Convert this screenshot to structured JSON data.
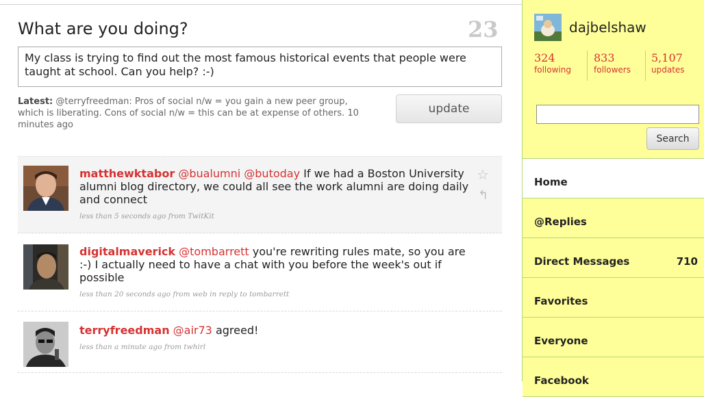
{
  "compose": {
    "heading": "What are you doing?",
    "char_count": "23",
    "status_text": "My class is trying to find out the most famous historical events that people were taught at school. Can you help? :-)",
    "latest_label": "Latest:",
    "latest_text": "@terryfreedman: Pros of social n/w = you gain a new peer group, which is liberating. Cons of social n/w = this can be at expense of others. 10 minutes ago",
    "update_label": "update"
  },
  "timeline": [
    {
      "user": "matthewktabor",
      "parts": [
        {
          "text": "@bualumni",
          "mention": true
        },
        {
          "text": " ",
          "mention": false
        },
        {
          "text": "@butoday",
          "mention": true
        },
        {
          "text": " If we had a Boston University alumni blog directory, we could all see the work alumni are doing daily and connect",
          "mention": false
        }
      ],
      "meta": "less than 5 seconds ago from TwitKit"
    },
    {
      "user": "digitalmaverick",
      "parts": [
        {
          "text": "@tombarrett",
          "mention": true
        },
        {
          "text": " you're rewriting rules mate, so you are :-) I actually need to have a chat with you before the week's out if possible",
          "mention": false
        }
      ],
      "meta": "less than 20 seconds ago from web in reply to tombarrett"
    },
    {
      "user": "terryfreedman",
      "parts": [
        {
          "text": "@air73",
          "mention": true
        },
        {
          "text": " agreed!",
          "mention": false
        }
      ],
      "meta": "less than a minute ago from twhirl"
    }
  ],
  "sidebar": {
    "username": "dajbelshaw",
    "stats": [
      {
        "num": "324",
        "label": "following"
      },
      {
        "num": "833",
        "label": "followers"
      },
      {
        "num": "5,107",
        "label": "updates"
      }
    ],
    "search_placeholder": "",
    "search_label": "Search",
    "nav": [
      {
        "label": "Home",
        "count": "",
        "active": true
      },
      {
        "label": "@Replies",
        "count": "",
        "active": false
      },
      {
        "label": "Direct Messages",
        "count": "710",
        "active": false
      },
      {
        "label": "Favorites",
        "count": "",
        "active": false
      },
      {
        "label": "Everyone",
        "count": "",
        "active": false
      },
      {
        "label": "Facebook",
        "count": "",
        "active": false
      }
    ]
  },
  "colors": {
    "sidebar_bg": "#ffff99",
    "sidebar_border": "#b6d67e",
    "accent_red": "#d63232"
  }
}
